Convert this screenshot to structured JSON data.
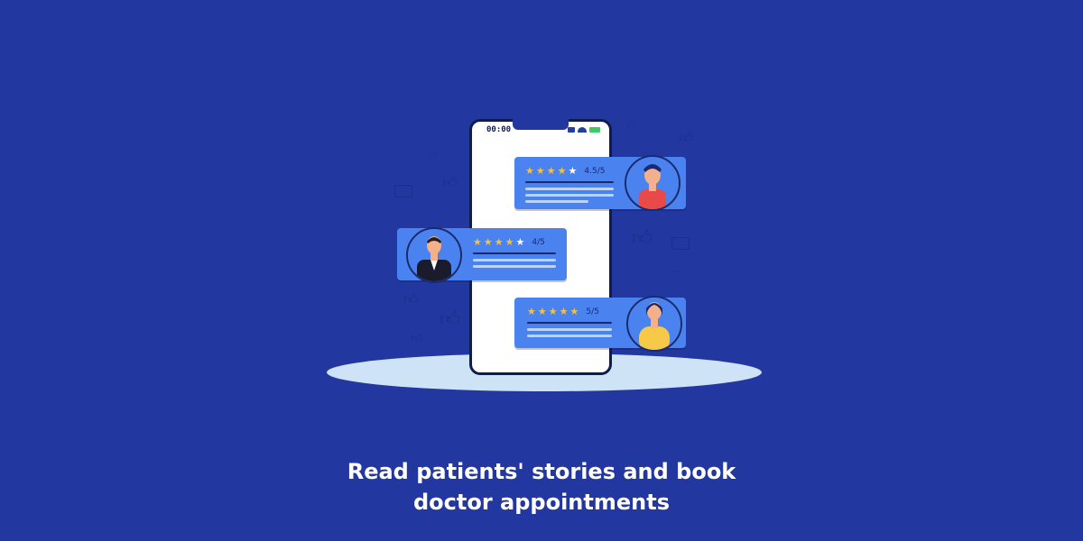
{
  "phone": {
    "status_time": "00:00",
    "status_icons": [
      "signal-icon",
      "wifi-icon",
      "battery-icon"
    ]
  },
  "reviews": [
    {
      "rating": 4.5,
      "rating_label": "4.5/5",
      "stars_filled": 4,
      "stars_total": 5,
      "avatar": "woman-red-shirt-avatar"
    },
    {
      "rating": 4,
      "rating_label": "4/5",
      "stars_filled": 4,
      "stars_total": 5,
      "avatar": "man-suit-avatar"
    },
    {
      "rating": 5,
      "rating_label": "5/5",
      "stars_filled": 5,
      "stars_total": 5,
      "avatar": "woman-yellow-shirt-avatar"
    }
  ],
  "headline": {
    "line1": "Read patients' stories and book",
    "line2": "doctor appointments"
  },
  "colors": {
    "background": "#2238a0",
    "card": "#4a82f0",
    "star": "#f5c33b",
    "platform": "#cfe3f7"
  },
  "decorations": [
    "thumbs-up-icon",
    "heart-icon",
    "chat-bubble-icon"
  ]
}
